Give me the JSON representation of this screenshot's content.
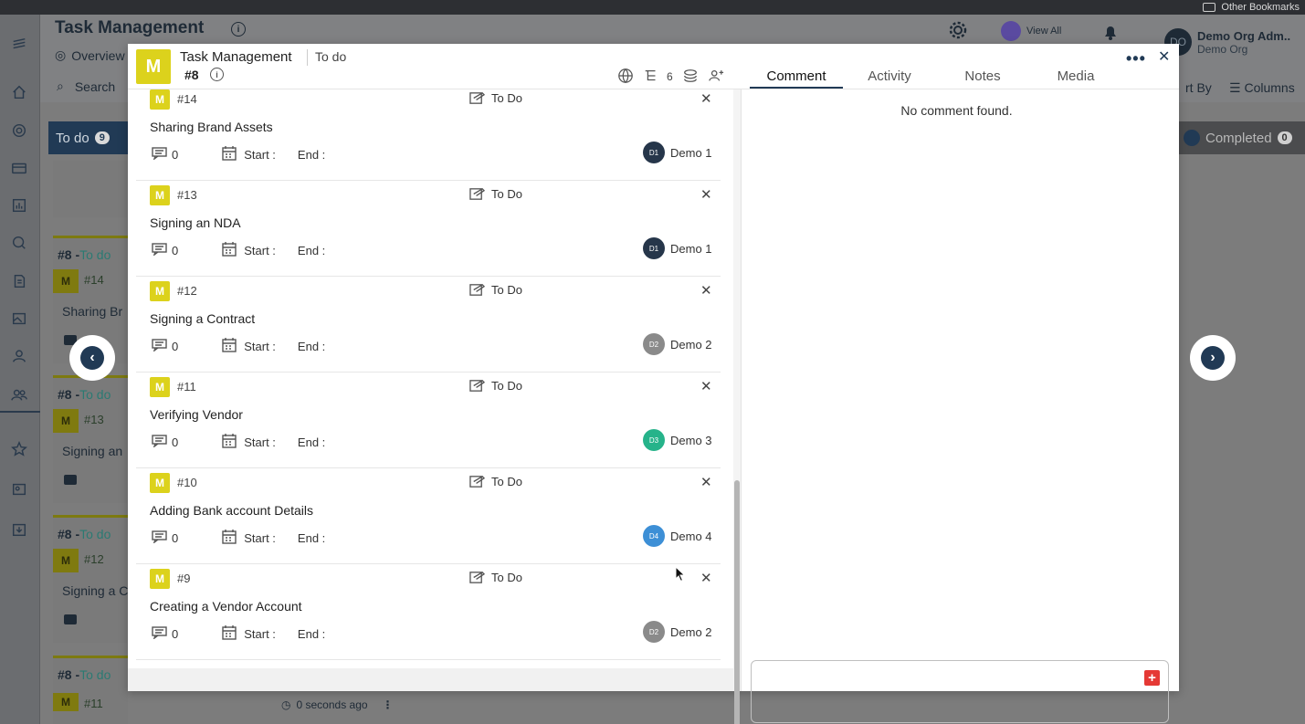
{
  "browser": {
    "bookmarks_label": "Other Bookmarks"
  },
  "app": {
    "title": "Task Management",
    "overview_label": "Overview",
    "search_placeholder": "Search",
    "view_all_label": "View All",
    "user": {
      "initials": "DO",
      "name": "Demo Org Adm..",
      "org": "Demo Org"
    },
    "sort_by_label": "rt By",
    "columns_label": "Columns"
  },
  "board": {
    "todo": {
      "label": "To do",
      "count": "9"
    },
    "completed": {
      "label": "Completed",
      "count": "0"
    },
    "cards": [
      {
        "prefix": "#8 -",
        "status": "To do",
        "badge": "M",
        "id": "#14",
        "name": "Sharing Br"
      },
      {
        "prefix": "#8 -",
        "status": "To do",
        "badge": "M",
        "id": "#13",
        "name": "Signing an"
      },
      {
        "prefix": "#8 -",
        "status": "To do",
        "badge": "M",
        "id": "#12",
        "name": "Signing a C"
      },
      {
        "prefix": "#8 -",
        "status": "To do",
        "badge": "M",
        "id": "#11",
        "name": ""
      }
    ],
    "footer_time": "0 seconds ago"
  },
  "modal": {
    "avatar": "M",
    "project": "Task Management",
    "status": "To do",
    "number": "#8",
    "subtask_count": "6",
    "tabs": [
      "Comment",
      "Activity",
      "Notes",
      "Media"
    ],
    "comment_empty": "No comment found.",
    "tasks": [
      {
        "badge": "M",
        "id": "#14",
        "status": "To Do",
        "name": "Sharing Brand Assets",
        "comments": "0",
        "start_label": "Start :",
        "end_label": "End :",
        "assignee_initials": "D1",
        "assignee": "Demo 1",
        "color": "#26364a"
      },
      {
        "badge": "M",
        "id": "#13",
        "status": "To Do",
        "name": "Signing an NDA",
        "comments": "0",
        "start_label": "Start :",
        "end_label": "End :",
        "assignee_initials": "D1",
        "assignee": "Demo 1",
        "color": "#26364a"
      },
      {
        "badge": "M",
        "id": "#12",
        "status": "To Do",
        "name": "Signing a Contract",
        "comments": "0",
        "start_label": "Start :",
        "end_label": "End :",
        "assignee_initials": "D2",
        "assignee": "Demo 2",
        "color": "#8a8a8a"
      },
      {
        "badge": "M",
        "id": "#11",
        "status": "To Do",
        "name": "Verifying Vendor",
        "comments": "0",
        "start_label": "Start :",
        "end_label": "End :",
        "assignee_initials": "D3",
        "assignee": "Demo 3",
        "color": "#26b38a"
      },
      {
        "badge": "M",
        "id": "#10",
        "status": "To Do",
        "name": "Adding Bank account Details",
        "comments": "0",
        "start_label": "Start :",
        "end_label": "End :",
        "assignee_initials": "D4",
        "assignee": "Demo 4",
        "color": "#3d8fd6"
      },
      {
        "badge": "M",
        "id": "#9",
        "status": "To Do",
        "name": "Creating a Vendor Account",
        "comments": "0",
        "start_label": "Start :",
        "end_label": "End :",
        "assignee_initials": "D2",
        "assignee": "Demo 2",
        "color": "#8a8a8a"
      }
    ]
  }
}
